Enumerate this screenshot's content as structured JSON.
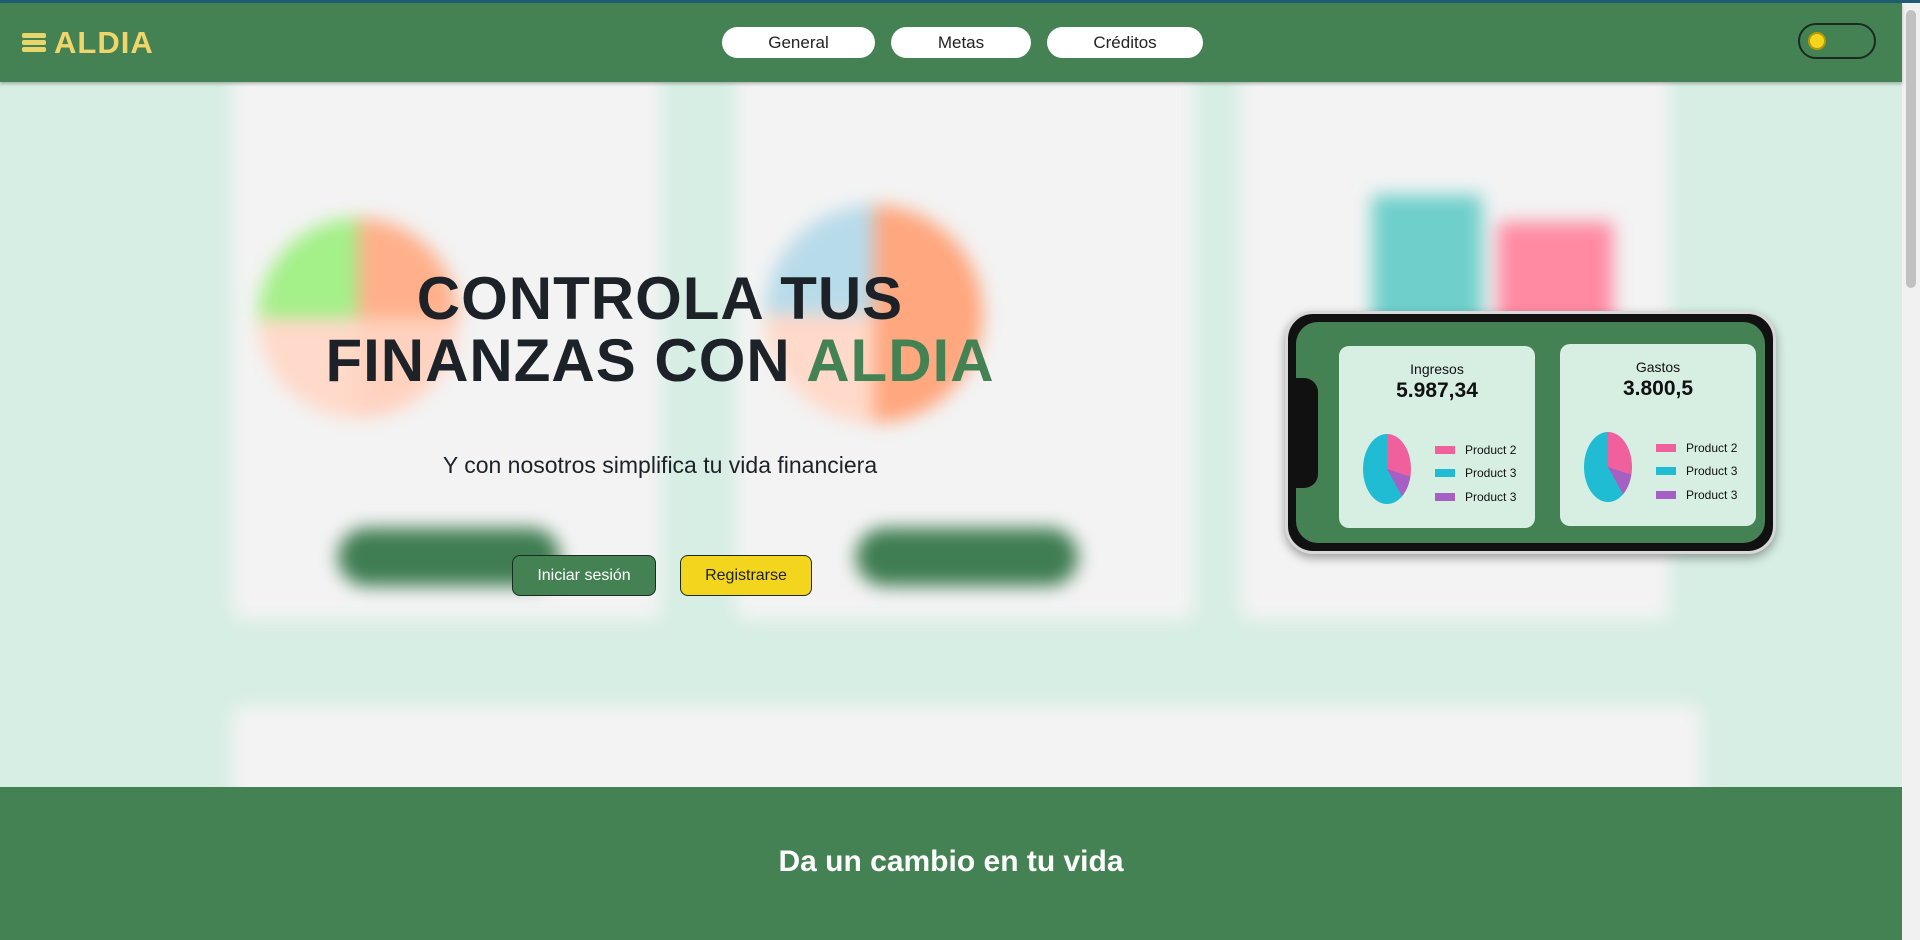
{
  "header": {
    "logo_text": "ALDIA",
    "nav": [
      {
        "label": "General"
      },
      {
        "label": "Metas"
      },
      {
        "label": "Créditos"
      }
    ],
    "theme_icon": "sun-icon"
  },
  "hero": {
    "title_line1": "CONTROLA TUS",
    "title_line2_prefix": "FINANZAS CON ",
    "title_accent": "ALDIA",
    "subtitle": "Y con nosotros simplifica tu vida financiera",
    "login_label": "Iniciar sesión",
    "register_label": "Registrarse"
  },
  "phone": {
    "cards": [
      {
        "title": "Ingresos",
        "value": "5.987,34",
        "legend": [
          {
            "label": "Product 2",
            "color": "#f0609d"
          },
          {
            "label": "Product 3",
            "color": "#20bcd4"
          },
          {
            "label": "Product 3",
            "color": "#a65fc2"
          }
        ]
      },
      {
        "title": "Gastos",
        "value": "3.800,5",
        "legend": [
          {
            "label": "Product 2",
            "color": "#f0609d"
          },
          {
            "label": "Product 3",
            "color": "#20bcd4"
          },
          {
            "label": "Product 3",
            "color": "#a65fc2"
          }
        ]
      }
    ]
  },
  "band": {
    "title": "Da un cambio en tu vida"
  },
  "colors": {
    "brand_green": "#448254",
    "accent_yellow": "#f2d51c",
    "page_bg": "#d6eee3"
  }
}
